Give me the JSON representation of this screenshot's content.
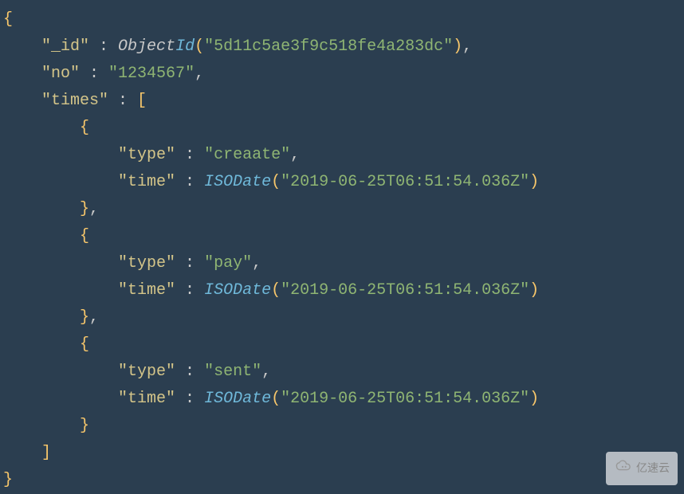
{
  "code": {
    "open_brace": "{",
    "line_id_key": "\"_id\"",
    "colon_sp": " : ",
    "obj_prefix": "Object",
    "id_fn": "Id",
    "open_paren": "(",
    "id_val": "\"5d11c5ae3f9c518fe4a283dc\"",
    "close_paren": ")",
    "comma": ",",
    "no_key": "\"no\"",
    "no_val": "\"1234567\"",
    "times_key": "\"times\"",
    "open_bracket": "[",
    "inner_open_brace": "{",
    "type_key": "\"type\"",
    "type_val_1": "\"creaate\"",
    "time_key": "\"time\"",
    "iso_fn": "ISODate",
    "time_val_1": "\"2019-06-25T06:51:54.036Z\"",
    "inner_close_brace": "}",
    "type_val_2": "\"pay\"",
    "time_val_2": "\"2019-06-25T06:51:54.036Z\"",
    "type_val_3": "\"sent\"",
    "time_val_3": "\"2019-06-25T06:51:54.036Z\"",
    "close_bracket": "]",
    "close_brace": "}"
  },
  "watermark": {
    "text": "亿速云"
  }
}
